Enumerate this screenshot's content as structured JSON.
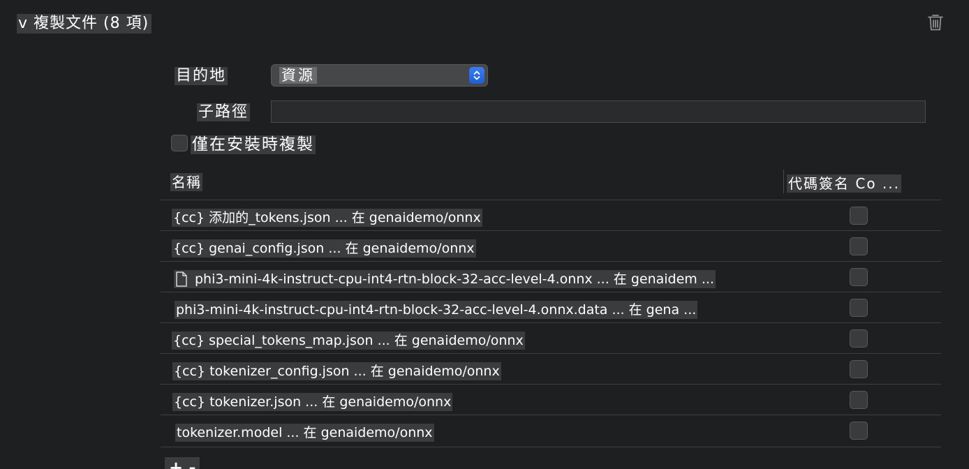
{
  "section": {
    "title": "v 複製文件 (8 項)",
    "delete_icon": "trash-icon"
  },
  "form": {
    "destination_label": "目的地",
    "destination_value": "資源",
    "subpath_label": "子路徑",
    "subpath_value": "",
    "install_only_label": "僅在安裝時複製",
    "install_only_checked": false
  },
  "table": {
    "columns": {
      "name": "名稱",
      "codesign": "代碼簽名 Co ..."
    },
    "rows": [
      {
        "label": "{cc} 添加的_tokens.json ... 在 genaidemo/onnx",
        "icon": "",
        "codesign": false
      },
      {
        "label": "{cc} genai_config.json ... 在 genaidemo/onnx",
        "icon": "",
        "codesign": false
      },
      {
        "label": "phi3-mini-4k-instruct-cpu-int4-rtn-block-32-acc-level-4.onnx ... 在 genaidem ...",
        "icon": "file-icon",
        "codesign": false
      },
      {
        "label": "phi3-mini-4k-instruct-cpu-int4-rtn-block-32-acc-level-4.onnx.data ... 在 gena ...",
        "icon": "",
        "codesign": false
      },
      {
        "label": "{cc} special_tokens_map.json ... 在 genaidemo/onnx",
        "icon": "",
        "codesign": false
      },
      {
        "label": "{cc} tokenizer_config.json ... 在 genaidemo/onnx",
        "icon": "",
        "codesign": false
      },
      {
        "label": "{cc} tokenizer.json ... 在 genaidemo/onnx",
        "icon": "",
        "codesign": false
      },
      {
        "label": "tokenizer.model ... 在 genaidemo/onnx",
        "icon": "",
        "codesign": false
      }
    ]
  },
  "footer": {
    "partial_text": "+ -"
  }
}
